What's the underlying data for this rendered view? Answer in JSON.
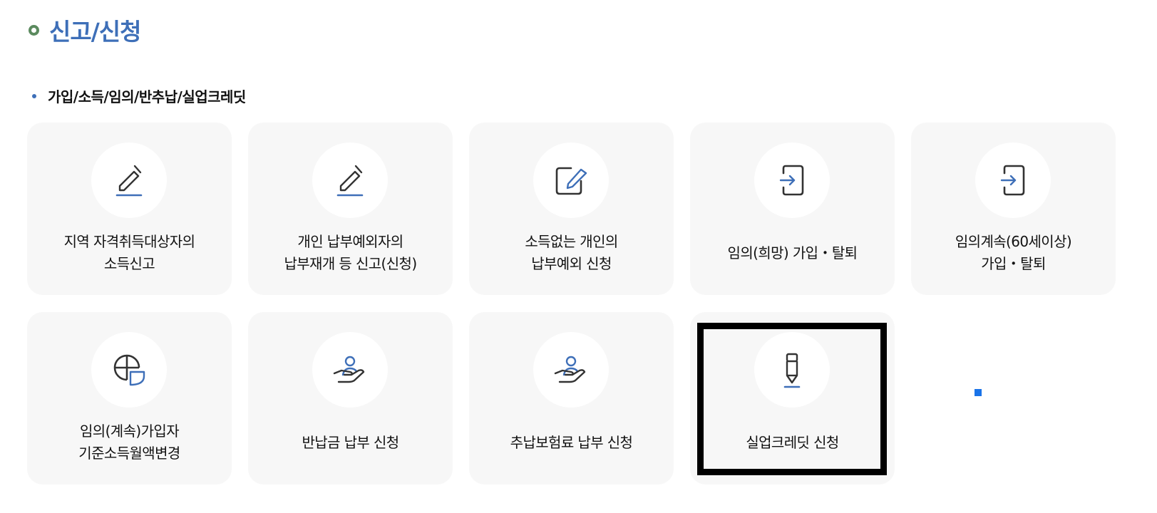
{
  "page": {
    "title": "신고/신청"
  },
  "section": {
    "heading": "가입/소득/임의/반추납/실업크레딧"
  },
  "cards": [
    {
      "label": "지역 자격취득대상자의\n소득신고",
      "icon": "pencil-edit-icon"
    },
    {
      "label": "개인 납부예외자의\n납부재개 등 신고(신청)",
      "icon": "pencil-edit-icon"
    },
    {
      "label": "소득없는 개인의\n납부예외 신청",
      "icon": "note-edit-icon"
    },
    {
      "label": "임의(희망) 가입・탈퇴",
      "icon": "sign-in-icon"
    },
    {
      "label": "임의계속(60세이상)\n가입・탈퇴",
      "icon": "sign-in-icon"
    },
    {
      "label": "임의(계속)가입자\n기준소득월액변경",
      "icon": "globe-shield-icon"
    },
    {
      "label": "반납금 납부 신청",
      "icon": "hand-person-icon"
    },
    {
      "label": "추납보험료 납부 신청",
      "icon": "hand-person-icon"
    },
    {
      "label": "실업크레딧 신청",
      "icon": "pencil-icon"
    }
  ],
  "colors": {
    "accent": "#3e6fb8",
    "icon_stroke": "#333333",
    "card_bg": "#f7f7f7",
    "title_bullet": "#5b8a5e"
  }
}
